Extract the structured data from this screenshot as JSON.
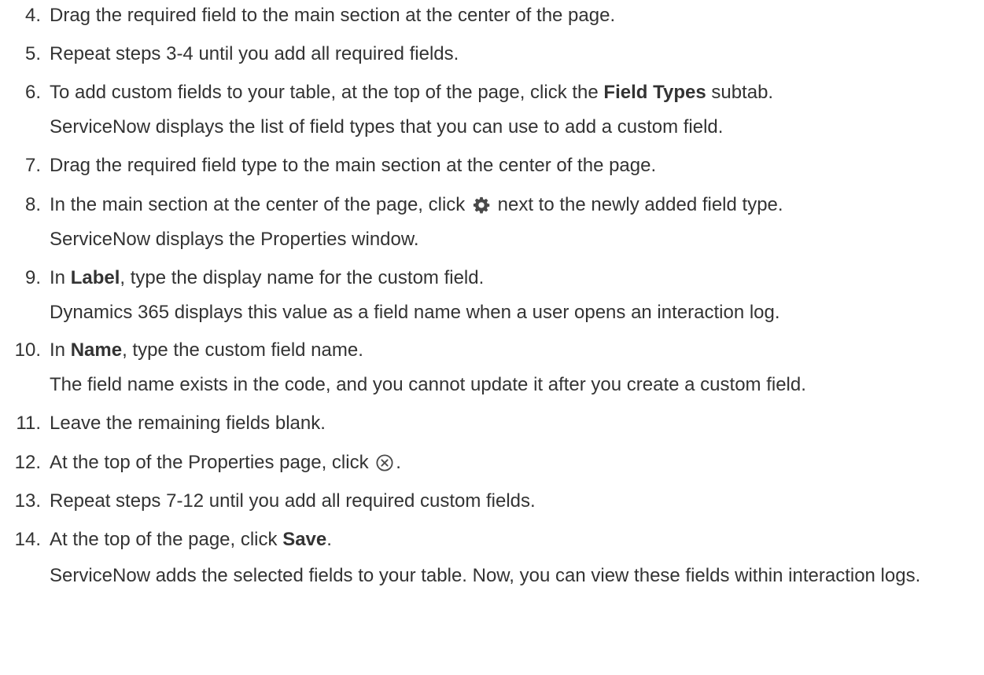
{
  "steps": [
    {
      "num": "4.",
      "text": "Drag the required field to the main section at the center of the page."
    },
    {
      "num": "5.",
      "text": "Repeat steps 3-4 until you add all required fields."
    },
    {
      "num": "6.",
      "pre": "To add custom fields to your table, at the top of the page, click the ",
      "bold": "Field Types",
      "post": " subtab.",
      "note": "ServiceNow displays the list of field types that you can use to add a custom field."
    },
    {
      "num": "7.",
      "text": "Drag the required field type to the main section at the center of the page."
    },
    {
      "num": "8.",
      "pre": "In the main section at the center of the page, click ",
      "icon": "gear-icon",
      "post": " next to the newly added field type.",
      "note": "ServiceNow displays the Properties window."
    },
    {
      "num": "9.",
      "pre": "In ",
      "bold": "Label",
      "post": ", type the display name for the custom field.",
      "note": "Dynamics 365 displays this value as a field name when a user opens an interaction log."
    },
    {
      "num": "10.",
      "pre": "In ",
      "bold": "Name",
      "post": ", type the custom field name.",
      "note": "The field name exists in the code, and you cannot update it after you create a custom field."
    },
    {
      "num": "11.",
      "text": "Leave the remaining fields blank."
    },
    {
      "num": "12.",
      "pre": "At the top of the Properties page, click ",
      "icon": "close-circle-icon",
      "post": "."
    },
    {
      "num": "13.",
      "text": "Repeat steps 7-12 until you add all required custom fields."
    },
    {
      "num": "14.",
      "pre": "At the top of the page, click ",
      "bold": "Save",
      "post": ".",
      "note": "ServiceNow adds the selected fields to your table. Now, you can view these fields within interaction logs."
    }
  ]
}
